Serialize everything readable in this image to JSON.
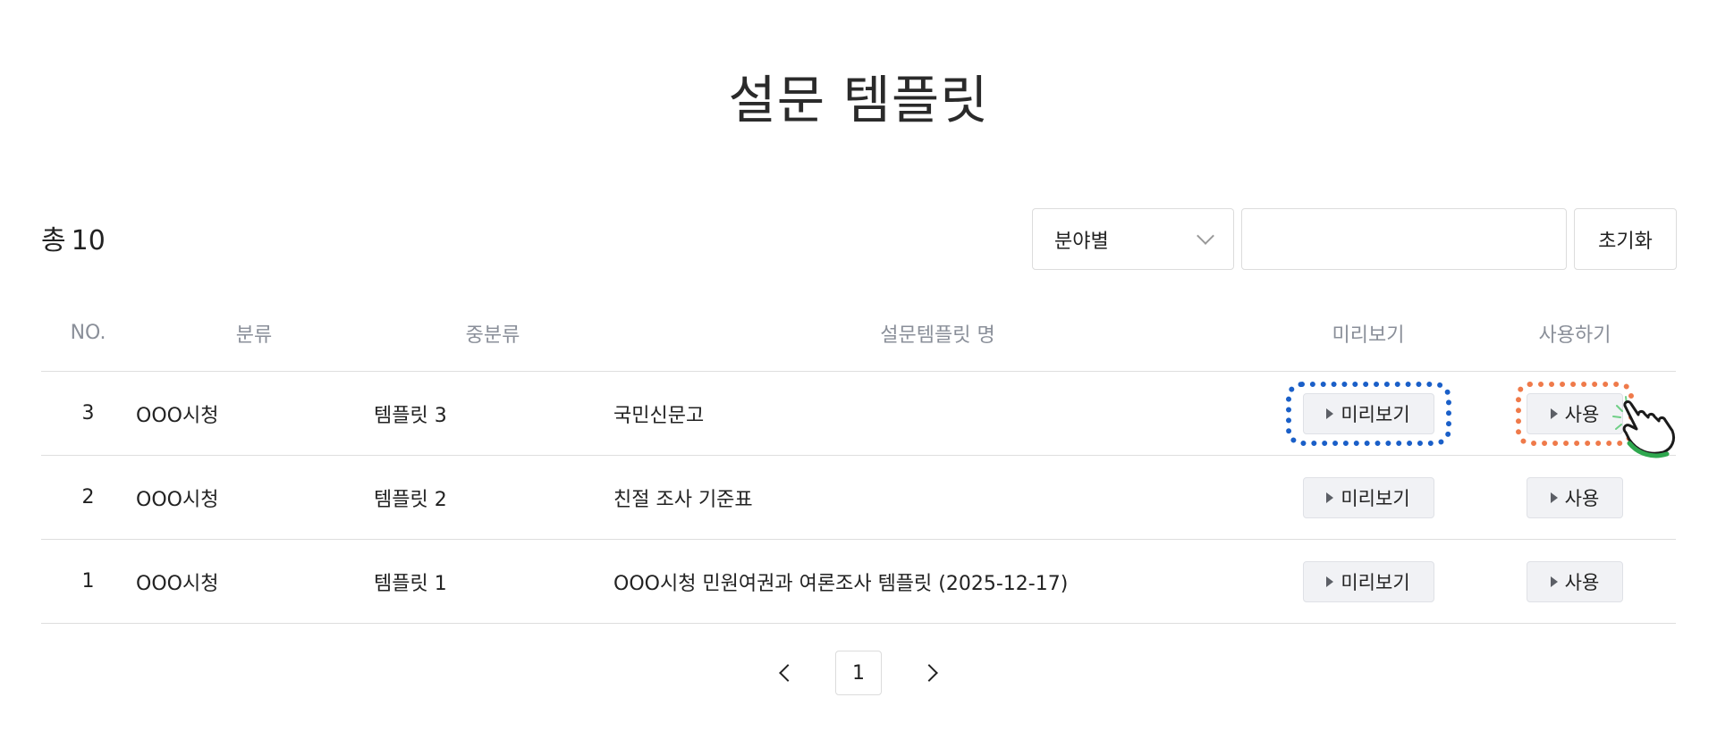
{
  "title": "설문 템플릿",
  "summary": {
    "total_label": "총",
    "total_count": "10"
  },
  "filters": {
    "category_selected": "분야별",
    "search_value": "",
    "reset_label": "초기화"
  },
  "table": {
    "headers": [
      "NO.",
      "분류",
      "중분류",
      "설문템플릿 명",
      "미리보기",
      "사용하기"
    ],
    "rows": [
      {
        "no": "3",
        "category": "OOO시청",
        "subcategory": "템플릿 3",
        "name": "국민신문고",
        "preview_label": "미리보기",
        "use_label": "사용"
      },
      {
        "no": "2",
        "category": "OOO시청",
        "subcategory": "템플릿 2",
        "name": "친절 조사 기준표",
        "preview_label": "미리보기",
        "use_label": "사용"
      },
      {
        "no": "1",
        "category": "OOO시청",
        "subcategory": "템플릿 1",
        "name": "OOO시청 민원여권과 여론조사 템플릿 (2025-12-17)",
        "preview_label": "미리보기",
        "use_label": "사용"
      }
    ]
  },
  "pagination": {
    "current_page": "1"
  },
  "icons": {
    "dropdown": "chevron-down-icon",
    "button_prefix": "play-triangle-icon",
    "prev": "chevron-left-icon",
    "next": "chevron-right-icon",
    "cursor": "hand-pointer-icon"
  },
  "colors": {
    "highlight_preview": "#1a5fc8",
    "highlight_use": "#ef7a4a",
    "header_text": "#8a8f99",
    "button_bg": "#f1f2f5"
  }
}
